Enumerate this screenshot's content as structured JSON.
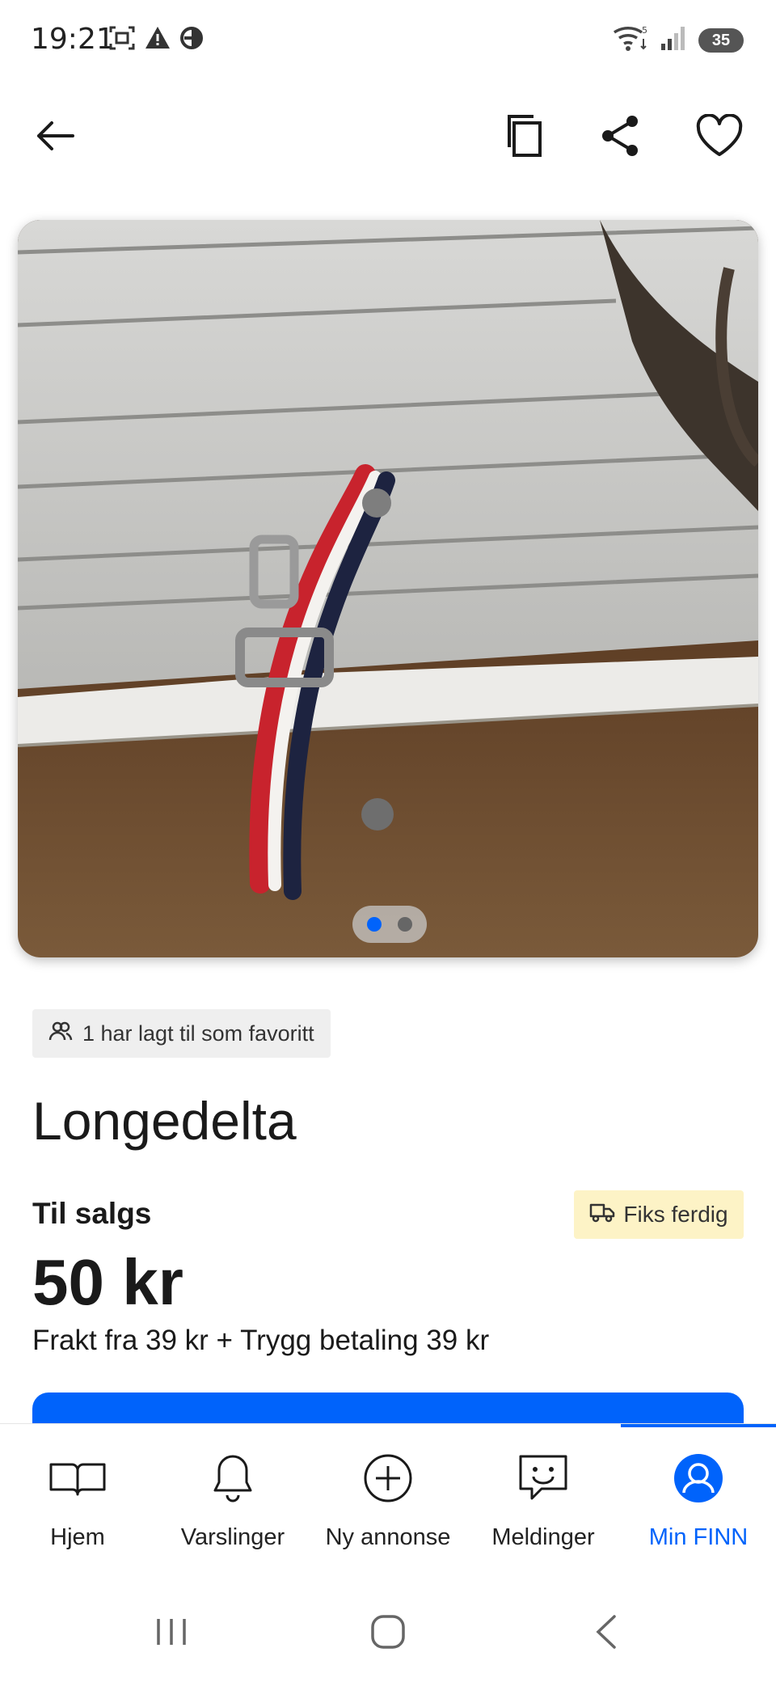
{
  "status_bar": {
    "time": "19:21",
    "battery": "35",
    "icons_left": [
      "screenshot-icon",
      "warning-icon",
      "data-saver-icon"
    ],
    "icons_right": [
      "wifi-icon",
      "signal-icon",
      "battery-icon"
    ]
  },
  "top_bar": {
    "icons": [
      "back-arrow-icon",
      "copy-icon",
      "share-icon",
      "heart-icon"
    ]
  },
  "gallery": {
    "image": "product-photo",
    "page_count": 2,
    "active_index": 0
  },
  "listing": {
    "favorites_text": "1 har lagt til som favoritt",
    "title": "Longedelta",
    "sale_label": "Til salgs",
    "fix_badge": "Fiks ferdig",
    "price": "50 kr",
    "shipping": "Frakt fra 39 kr + Trygg betaling 39 kr"
  },
  "bottom_nav": {
    "items": [
      {
        "label": "Hjem",
        "icon": "book-icon"
      },
      {
        "label": "Varslinger",
        "icon": "bell-icon"
      },
      {
        "label": "Ny annonse",
        "icon": "plus-circle-icon"
      },
      {
        "label": "Meldinger",
        "icon": "chat-icon"
      },
      {
        "label": "Min FINN",
        "icon": "profile-icon"
      }
    ],
    "active_index": 4
  },
  "colors": {
    "accent": "#0063fb",
    "badge_bg": "#fdf3c6",
    "chip_bg": "#efefef",
    "text": "#1a1a1a"
  }
}
